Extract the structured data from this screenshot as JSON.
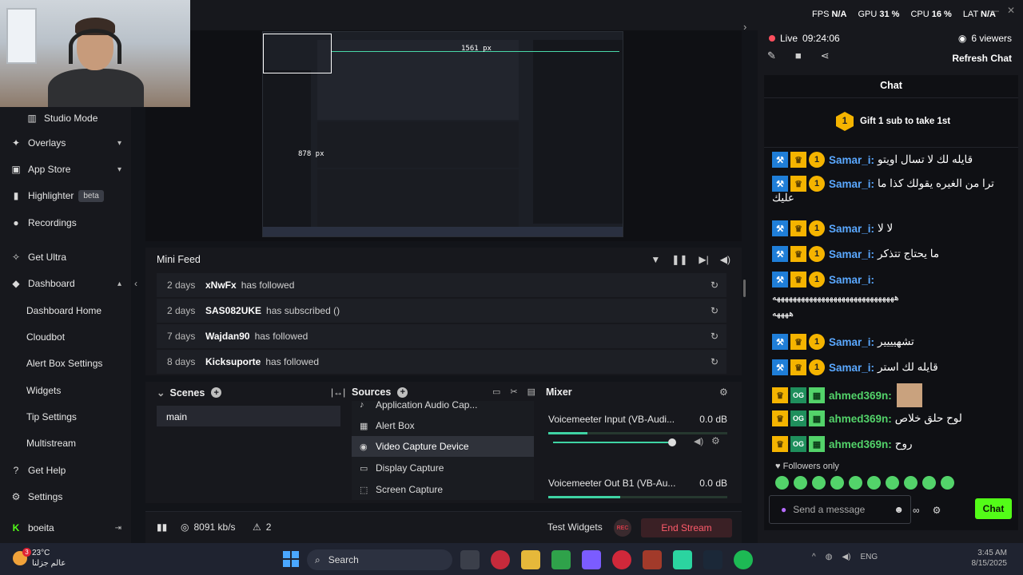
{
  "stats": {
    "fps_label": "FPS",
    "fps_value": "N/A",
    "gpu_label": "GPU",
    "gpu_value": "31 %",
    "cpu_label": "CPU",
    "cpu_value": "16 %",
    "lat_label": "LAT",
    "lat_value": "N/A"
  },
  "sidebar": {
    "items": [
      {
        "label": "Studio Mode"
      },
      {
        "label": "Overlays"
      },
      {
        "label": "App Store"
      },
      {
        "label": "Highlighter",
        "badge": "beta"
      },
      {
        "label": "Recordings"
      },
      {
        "label": "Get Ultra"
      },
      {
        "label": "Dashboard"
      },
      {
        "label": "Dashboard Home"
      },
      {
        "label": "Cloudbot"
      },
      {
        "label": "Alert Box Settings"
      },
      {
        "label": "Widgets"
      },
      {
        "label": "Tip Settings"
      },
      {
        "label": "Multistream"
      },
      {
        "label": "Get Help"
      },
      {
        "label": "Settings"
      },
      {
        "label": "boeita"
      }
    ]
  },
  "preview": {
    "width_label": "1561 px",
    "height_label": "878 px"
  },
  "minifeed": {
    "title": "Mini Feed",
    "rows": [
      {
        "days": "2 days",
        "user": "xNwFx",
        "action": "has followed"
      },
      {
        "days": "2 days",
        "user": "SAS082UKE",
        "action": "has subscribed ()"
      },
      {
        "days": "7 days",
        "user": "Wajdan90",
        "action": "has followed"
      },
      {
        "days": "8 days",
        "user": "Kicksuporte",
        "action": "has followed"
      }
    ]
  },
  "scenes": {
    "title": "Scenes",
    "items": [
      "main"
    ]
  },
  "sources": {
    "title": "Sources",
    "items": [
      "Application Audio Cap...",
      "Alert Box",
      "Video Capture Device",
      "Display Capture",
      "Screen Capture"
    ],
    "active": "Video Capture Device"
  },
  "mixer": {
    "title": "Mixer",
    "channels": [
      {
        "name": "Voicemeeter Input (VB-Audi...",
        "db": "0.0 dB",
        "level": 0.22
      },
      {
        "name": "Voicemeeter Out B1 (VB-Au...",
        "db": "0.0 dB",
        "level": 0.4
      }
    ]
  },
  "footer": {
    "bitrate": "8091 kb/s",
    "warnings": "2",
    "test_widgets": "Test Widgets",
    "rec": "REC",
    "end_stream": "End Stream"
  },
  "chat": {
    "live_label": "Live",
    "live_time": "09:24:06",
    "viewers": "6 viewers",
    "refresh": "Refresh Chat",
    "title": "Chat",
    "gift_count": "1",
    "gift_text": "Gift 1 sub to take 1st",
    "messages": [
      {
        "user": "Samar_i:",
        "text": "قايله لك لا تسال اويتو",
        "type": "samar"
      },
      {
        "user": "Samar_i:",
        "text": "ترا من الغيره يقولك كذا ما",
        "type": "samar"
      },
      {
        "user": "",
        "text": "عليك",
        "type": "cont"
      },
      {
        "user": "Samar_i:",
        "text": "لا لا",
        "type": "samar"
      },
      {
        "user": "Samar_i:",
        "text": "ما يحتاج تتذكر",
        "type": "samar"
      },
      {
        "user": "Samar_i:",
        "text": "",
        "type": "samar"
      },
      {
        "user": "",
        "text": "ههههههههههههههههههههههههههههههه",
        "type": "cont"
      },
      {
        "user": "",
        "text": "ههههه",
        "type": "cont"
      },
      {
        "user": "Samar_i:",
        "text": "تشهيييير",
        "type": "samar"
      },
      {
        "user": "Samar_i:",
        "text": "قايله لك استر",
        "type": "samar"
      },
      {
        "user": "ahmed369n:",
        "text": "",
        "type": "ahmed"
      },
      {
        "user": "ahmed369n:",
        "text": "لوح حلق خلاص",
        "type": "ahmed"
      },
      {
        "user": "ahmed369n:",
        "text": "روح",
        "type": "ahmed"
      }
    ],
    "followers_only": "Followers only",
    "placeholder": "Send a message",
    "send_label": "Chat"
  },
  "taskbar": {
    "temp": "23°C",
    "location": "عالم جزلنا",
    "notif": "3",
    "search": "Search",
    "lang": "ENG",
    "time": "3:45 AM",
    "date": "8/15/2025"
  },
  "colors": {
    "accent": "#53fc18",
    "live": "#ff4f5e",
    "meter": "#3fd4a4",
    "samar": "#5aa8ff",
    "ahmed": "#53d36a"
  }
}
